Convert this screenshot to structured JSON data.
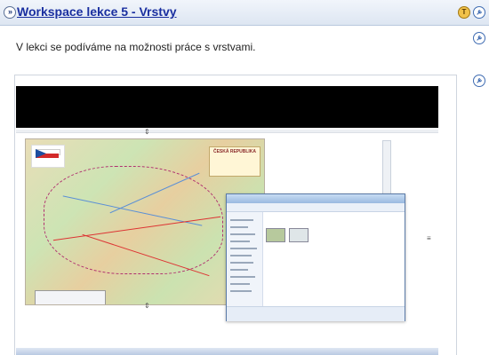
{
  "header": {
    "expand_glyph": "»",
    "title": "Workspace lekce 5 - Vrstvy",
    "icons": [
      "info-badge-icon",
      "edit-settings-icon"
    ]
  },
  "content": {
    "description": "V lekci se podíváme na možnosti práce s vrstvami."
  },
  "video": {
    "map_title": "ČESKÁ REPUBLIKA"
  },
  "colors": {
    "title_link": "#1a2fa0",
    "header_bg": "#dde6f2",
    "badge_yellow": "#f1c24b",
    "icon_blue": "#3f6cb2"
  }
}
